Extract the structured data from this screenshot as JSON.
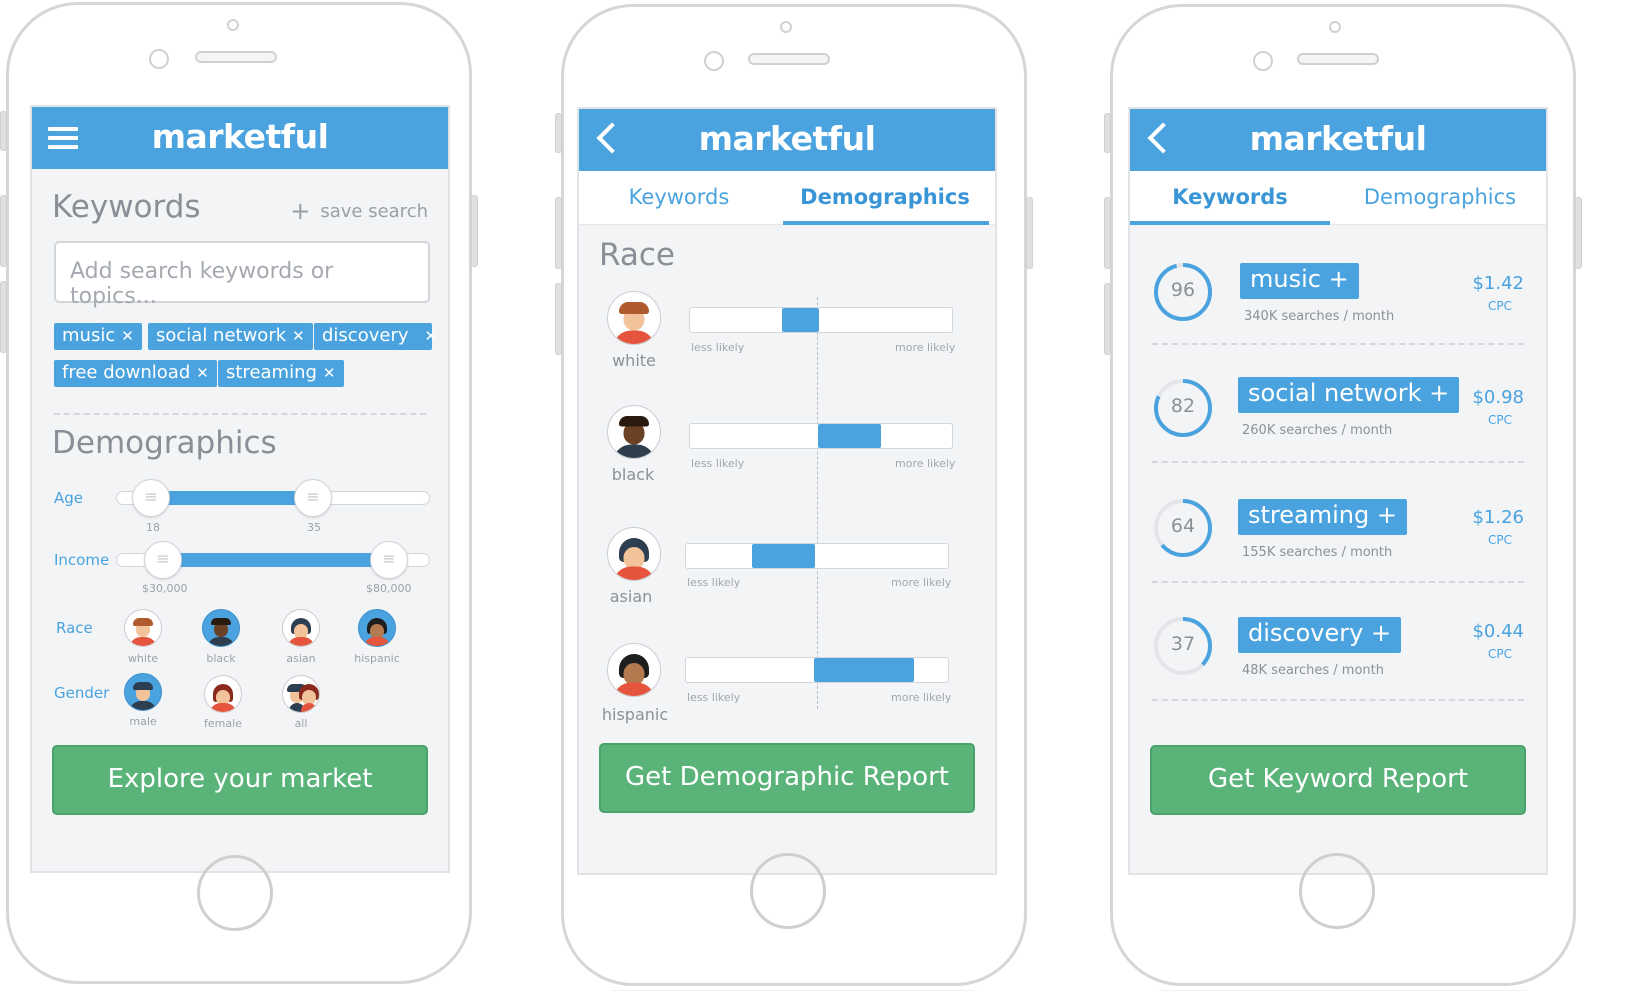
{
  "brand": "marketful",
  "colors": {
    "primary": "#4aa3df",
    "cta": "#5ab47a",
    "background": "#f3f4f6"
  },
  "icons": {
    "menu": "hamburger-icon",
    "back": "chevron-left-icon",
    "add": "plus-icon",
    "remove": "close-icon"
  },
  "phone1": {
    "keywords_title": "Keywords",
    "save_search": "save search",
    "search_placeholder": "Add search keywords or topics...",
    "chips": [
      "music",
      "social network",
      "discovery",
      "free download",
      "streaming"
    ],
    "demographics_title": "Demographics",
    "age": {
      "label": "Age",
      "min_label": "18",
      "max_label": "35",
      "range": [
        18,
        35
      ]
    },
    "income": {
      "label": "Income",
      "min_label": "$30,000",
      "max_label": "$80,000",
      "range": [
        30000,
        80000
      ]
    },
    "race": {
      "label": "Race",
      "options": [
        "white",
        "black",
        "asian",
        "hispanic"
      ],
      "selected": "hispanic"
    },
    "gender": {
      "label": "Gender",
      "options": [
        "male",
        "female",
        "all"
      ],
      "selected": "male"
    },
    "cta": "Explore your market"
  },
  "phone2": {
    "tabs": [
      "Keywords",
      "Demographics"
    ],
    "active_tab": "Demographics",
    "race_title": "Race",
    "less_label": "less likely",
    "more_label": "more likely",
    "rows": [
      {
        "name": "white",
        "from": 0.35,
        "to": 0.49
      },
      {
        "name": "black",
        "from": 0.49,
        "to": 0.73
      },
      {
        "name": "asian",
        "from": 0.25,
        "to": 0.49
      },
      {
        "name": "hispanic",
        "from": 0.49,
        "to": 0.87
      }
    ],
    "cta": "Get Demographic Report"
  },
  "phone3": {
    "tabs": [
      "Keywords",
      "Demographics"
    ],
    "active_tab": "Keywords",
    "cpc_label": "CPC",
    "items": [
      {
        "score": "96",
        "keyword": "music",
        "searches": "340K searches / month",
        "price": "$1.42"
      },
      {
        "score": "82",
        "keyword": "social network",
        "searches": "260K searches / month",
        "price": "$0.98"
      },
      {
        "score": "64",
        "keyword": "streaming",
        "searches": "155K searches / month",
        "price": "$1.26"
      },
      {
        "score": "37",
        "keyword": "discovery",
        "searches": "48K searches / month",
        "price": "$0.44"
      }
    ],
    "cta": "Get Keyword Report"
  }
}
